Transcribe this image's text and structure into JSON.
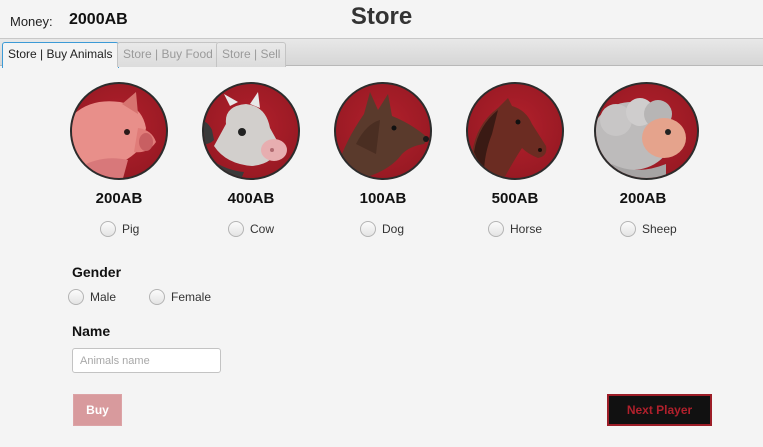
{
  "header": {
    "money_label": "Money:",
    "money_value": "2000AB",
    "title": "Store"
  },
  "tabs": [
    {
      "label": "Store | Buy Animals",
      "active": true
    },
    {
      "label": "Store | Buy Food",
      "active": false
    },
    {
      "label": "Store | Sell",
      "active": false
    }
  ],
  "animals": [
    {
      "name": "Pig",
      "price": "200AB",
      "icon": "pig-icon"
    },
    {
      "name": "Cow",
      "price": "400AB",
      "icon": "cow-icon"
    },
    {
      "name": "Dog",
      "price": "100AB",
      "icon": "dog-icon"
    },
    {
      "name": "Horse",
      "price": "500AB",
      "icon": "horse-icon"
    },
    {
      "name": "Sheep",
      "price": "200AB",
      "icon": "sheep-icon"
    }
  ],
  "gender": {
    "label": "Gender",
    "options": [
      "Male",
      "Female"
    ]
  },
  "name": {
    "label": "Name",
    "placeholder": "Animals name",
    "value": ""
  },
  "buttons": {
    "buy": "Buy",
    "next_player": "Next Player"
  },
  "colors": {
    "accent": "#a31d28",
    "tab_focus": "#3c9ad6",
    "buy_disabled": "#d89a9d"
  }
}
